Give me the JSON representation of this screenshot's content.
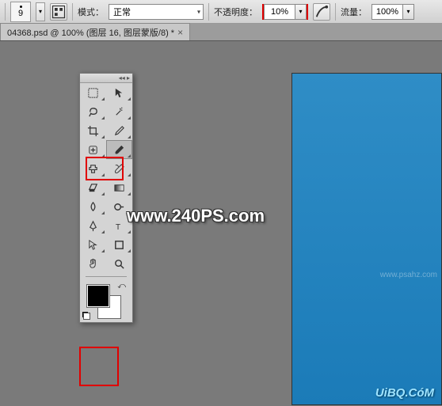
{
  "topbar": {
    "brush_size": "9",
    "mode_label": "模式：",
    "mode_value": "正常",
    "opacity_label": "不透明度：",
    "opacity_value": "10%",
    "flow_label": "流量：",
    "flow_value": "100%"
  },
  "tab": {
    "filename": "04368.psd @ 100% (图层 16, 图层蒙版/8) *"
  },
  "icons": {
    "panel_toggle": "囗",
    "pressure": "✎",
    "airbrush": "ℐ",
    "collapse": "◂◂ ▸"
  },
  "tools": {
    "move": "move-tool",
    "marquee": "marquee-tool",
    "lasso": "lasso-tool",
    "wand": "magic-wand-tool",
    "crop": "crop-tool",
    "eyedropper": "eyedropper-tool",
    "healing": "healing-brush-tool",
    "brush": "brush-tool",
    "stamp": "clone-stamp-tool",
    "history": "history-brush-tool",
    "eraser": "eraser-tool",
    "gradient": "gradient-tool",
    "blur": "blur-tool",
    "dodge": "dodge-tool",
    "pen": "pen-tool",
    "type": "type-tool",
    "path": "path-selection-tool",
    "shape": "shape-tool",
    "hand": "hand-tool",
    "zoom": "zoom-tool"
  },
  "colors": {
    "foreground": "#000000",
    "background": "#ffffff",
    "canvas": "#2389c4",
    "highlight": "#e00000"
  },
  "watermarks": {
    "main": "www.240PS.com",
    "corner": "UiBQ.CóM",
    "side": "www.psahz.com"
  }
}
